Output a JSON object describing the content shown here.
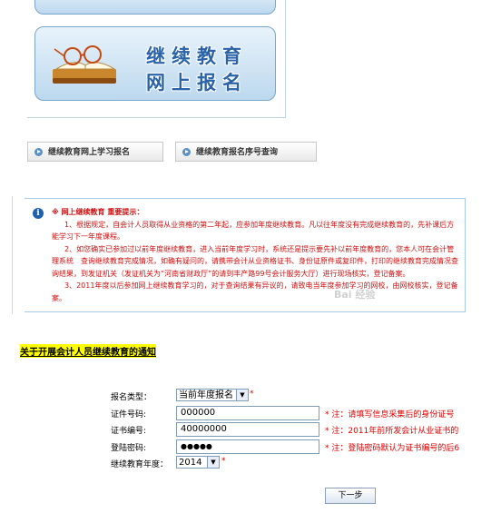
{
  "banner": {
    "title_line1": "继续教育",
    "title_line2": "网上报名"
  },
  "tabs": [
    {
      "label": "继续教育网上学习报名"
    },
    {
      "label": "继续教育报名序号查询"
    }
  ],
  "notice": {
    "heading": "※ 网上继续教育  重要提示：",
    "paragraphs": [
      "1、根据规定，自会计人员取得从业资格的第二年起，应参加年度继续教育。凡以往年度没有完成继续教育的，先补课后方能学习下一年度课程。",
      "2、如您确实已参加过以前年度继续教育，进入当前年度学习时，系统还是提示要先补以前年度教育的，您本人可在会计管理系统　查询继续教育完成情况，如确有疑问的，请携带会计从业资格证书、身份证原件或复印件，打印的继续教育完成情况查询结果，到发证机关（发证机关为“河南省财政厅”的请到丰产路99号会计服务大厅）进行现场核实，登记备案。",
      "3、2011年度以后参加网上继续教育学习的，对于查询结果有异议的，请致电当年度参加学习的网校，由网校核实，登记备案。"
    ]
  },
  "watermark": "Bai 经验",
  "link_text": "关于开展会计人员继续教育的通知",
  "form": {
    "type_label": "报名类型：",
    "type_value": "当前年度报名",
    "id_label": "证件号码:",
    "id_value": "000000",
    "id_hint": "* 注：请填写信息采集后的身份证号",
    "cert_label": "证书编号:",
    "cert_value": "40000000",
    "cert_hint": "* 注：2011年前所发会计从业证书的",
    "pwd_label": "登陆密码:",
    "pwd_value": "●●●●●",
    "pwd_hint": "* 注：登陆密码默认为证书编号的后6",
    "year_label": "继续教育年度：",
    "year_value": "2014",
    "star": "*",
    "next_label": "下一步"
  }
}
